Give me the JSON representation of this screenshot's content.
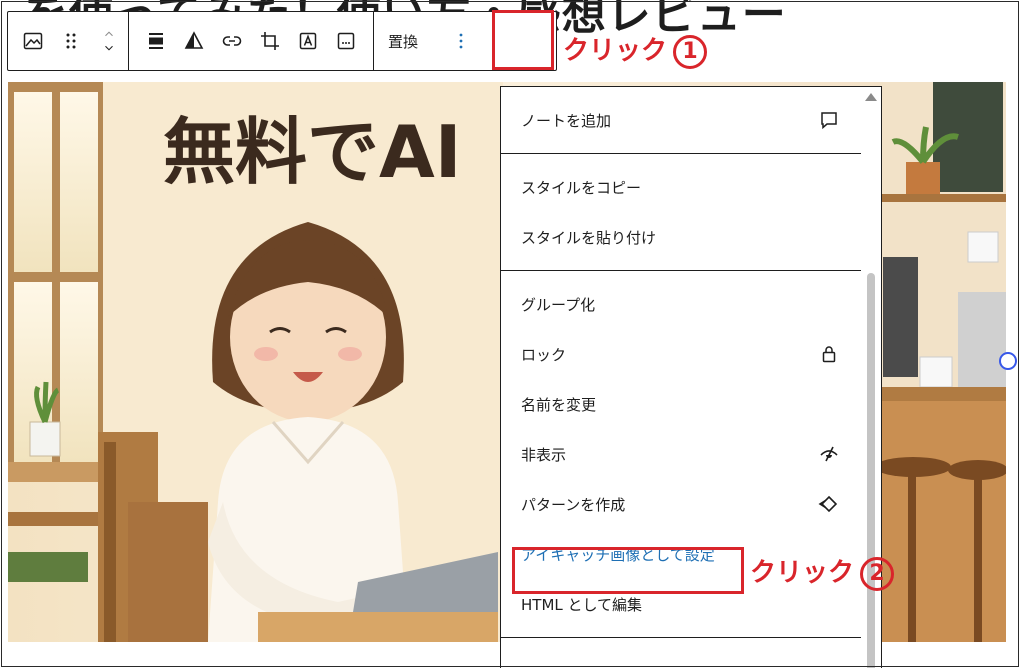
{
  "post": {
    "title": "を使ってみた！使い方・感想レビュー"
  },
  "toolbar": {
    "replace_label": "置換",
    "more_icon": "⋮"
  },
  "illustration": {
    "headline": "無料でAI"
  },
  "annotations": {
    "click1": "クリック",
    "click1_num": "1",
    "click2": "クリック",
    "click2_num": "2"
  },
  "menu": {
    "groups": [
      [
        {
          "label": "ノートを追加",
          "icon": "comment-icon"
        }
      ],
      [
        {
          "label": "スタイルをコピー"
        },
        {
          "label": "スタイルを貼り付け"
        }
      ],
      [
        {
          "label": "グループ化"
        },
        {
          "label": "ロック",
          "icon": "lock-icon"
        },
        {
          "label": "名前を変更"
        },
        {
          "label": "非表示",
          "icon": "hidden-eye-icon"
        },
        {
          "label": "パターンを作成",
          "icon": "pattern-symbol-icon"
        },
        {
          "label": "アイキャッチ画像として設定"
        },
        {
          "label": "HTML として編集"
        }
      ]
    ]
  },
  "colors": {
    "accent": "#1e6fb4",
    "annotation_red": "#d9252b"
  }
}
